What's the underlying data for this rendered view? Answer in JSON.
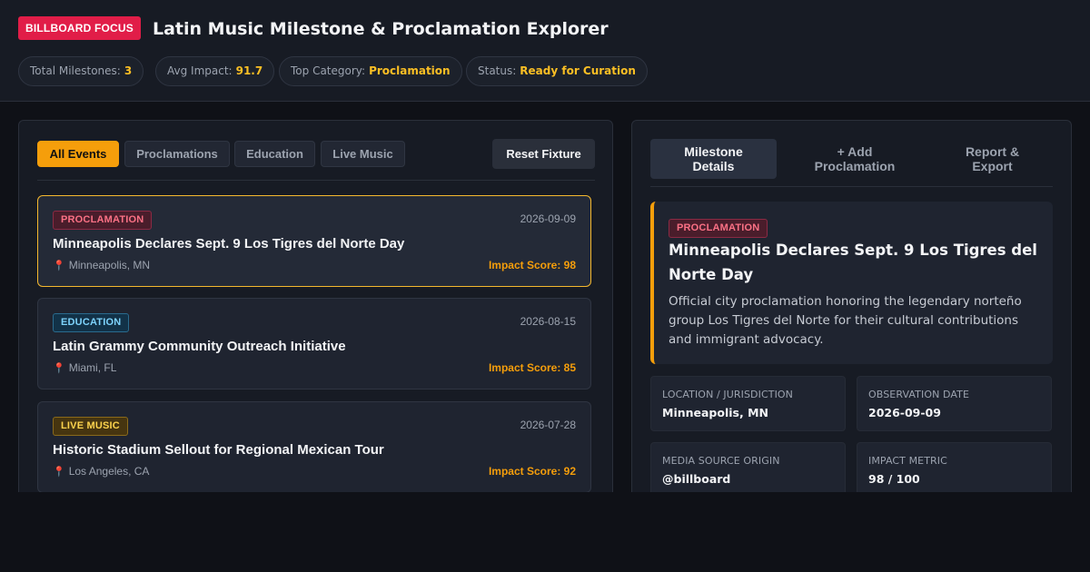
{
  "header": {
    "brand_badge": "BILLBOARD FOCUS",
    "title": "Latin Music Milestone & Proclamation Explorer",
    "stats": [
      {
        "label": "Total Milestones:",
        "value": "3"
      },
      {
        "label": "Avg Impact:",
        "value": "91.7"
      },
      {
        "label": "Top Category:",
        "value": "Proclamation"
      },
      {
        "label": "Status:",
        "value": "Ready for Curation"
      }
    ]
  },
  "filters": {
    "buttons": [
      "All Events",
      "Proclamations",
      "Education",
      "Live Music"
    ],
    "active": "All Events",
    "reset_label": "Reset Fixture"
  },
  "events": [
    {
      "tag": "PROCLAMATION",
      "date": "2026-09-09",
      "title": "Minneapolis Declares Sept. 9 Los Tigres del Norte Day",
      "location": "Minneapolis, MN",
      "impact": "Impact Score: 98",
      "selected": true
    },
    {
      "tag": "EDUCATION",
      "date": "2026-08-15",
      "title": "Latin Grammy Community Outreach Initiative",
      "location": "Miami, FL",
      "impact": "Impact Score: 85",
      "selected": false
    },
    {
      "tag": "LIVE MUSIC",
      "date": "2026-07-28",
      "title": "Historic Stadium Sellout for Regional Mexican Tour",
      "location": "Los Angeles, CA",
      "impact": "Impact Score: 92",
      "selected": false
    }
  ],
  "detail_tabs": [
    {
      "line1": "Milestone",
      "line2": "Details"
    },
    {
      "line1": "+ Add",
      "line2": "Proclamation"
    },
    {
      "line1": "Report &",
      "line2": "Export"
    }
  ],
  "detail": {
    "tag": "PROCLAMATION",
    "title": "Minneapolis Declares Sept. 9 Los Tigres del Norte Day",
    "description": "Official city proclamation honoring the legendary norteño group Los Tigres del Norte for their cultural contributions and immigrant advocacy.",
    "info": [
      {
        "label": "LOCATION / JURISDICTION",
        "value": "Minneapolis, MN"
      },
      {
        "label": "OBSERVATION DATE",
        "value": "2026-09-09"
      },
      {
        "label": "MEDIA SOURCE ORIGIN",
        "value": "@billboard"
      },
      {
        "label": "IMPACT METRIC",
        "value": "98 / 100"
      }
    ]
  },
  "colors": {
    "accent": "#f59e0b",
    "brand": "#e11d48",
    "background": "#0f1117"
  }
}
